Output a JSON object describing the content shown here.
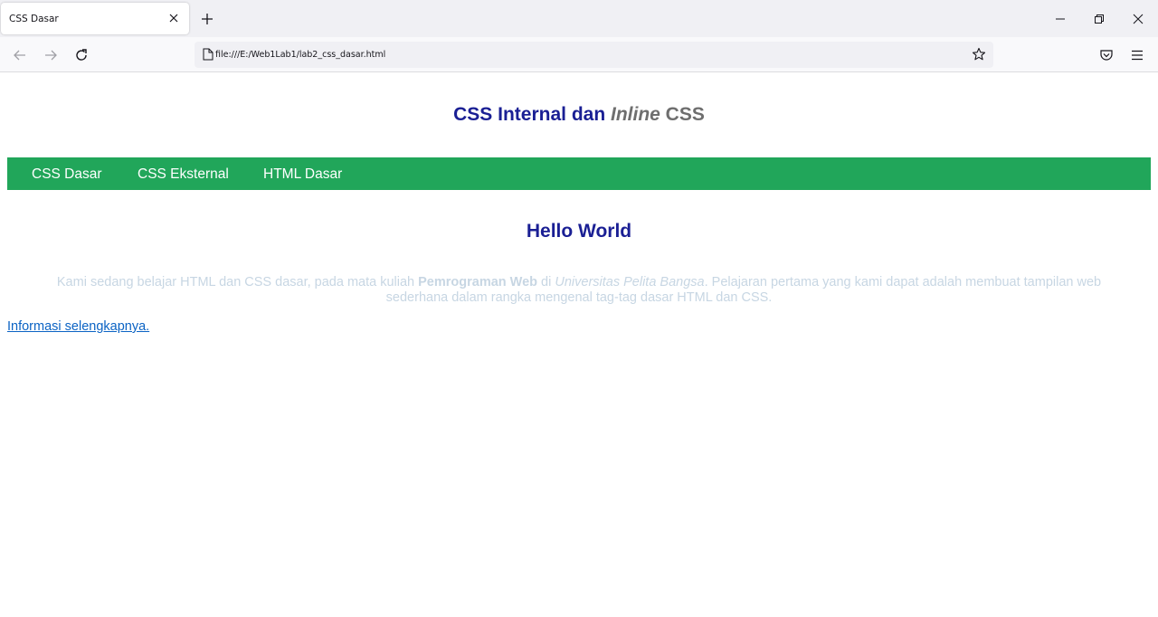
{
  "browser": {
    "tab": {
      "title": "CSS Dasar"
    },
    "url": "file:///E:/Web1Lab1/lab2_css_dasar.html",
    "icons": {
      "tab_close": "close-icon",
      "new_tab": "plus-icon",
      "minimize": "minimize-icon",
      "restore": "restore-icon",
      "close": "close-icon",
      "back": "arrow-left-icon",
      "forward": "arrow-right-icon",
      "reload": "reload-icon",
      "page": "page-icon",
      "bookmark": "star-icon",
      "pocket": "pocket-icon",
      "menu": "hamburger-menu-icon"
    }
  },
  "page": {
    "header": {
      "part1": "CSS Internal dan ",
      "part2": "Inline",
      "part3": " CSS"
    },
    "nav": [
      "CSS Dasar",
      "CSS Eksternal",
      "HTML Dasar"
    ],
    "heading": "Hello World",
    "intro": {
      "t1": "Kami sedang belajar HTML dan CSS dasar, pada mata kuliah ",
      "bold": "Pemrograman Web",
      "t2": " di ",
      "italic": "Universitas Pelita Bangsa",
      "t3": ". Pelajaran pertama yang kami dapat adalah membuat tampilan web sederhana dalam rangka mengenal tag-tag dasar HTML dan CSS."
    },
    "more_link": "Informasi selengkapnya."
  },
  "colors": {
    "nav_bg": "#21a65a",
    "heading": "#1a1f94",
    "intro_text": "#c7d6e3",
    "link": "#0b63c4"
  }
}
